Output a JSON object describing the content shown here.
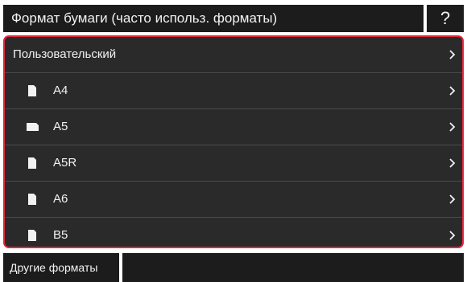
{
  "header": {
    "title": "Формат бумаги (часто использ. форматы)",
    "help_label": "?"
  },
  "list": {
    "items": [
      {
        "label": "Пользовательский",
        "icon": "none"
      },
      {
        "label": "A4",
        "icon": "portrait-paper-icon"
      },
      {
        "label": "A5",
        "icon": "landscape-paper-icon"
      },
      {
        "label": "A5R",
        "icon": "portrait-paper-icon"
      },
      {
        "label": "A6",
        "icon": "portrait-paper-icon"
      },
      {
        "label": "B5",
        "icon": "portrait-paper-icon"
      }
    ]
  },
  "footer": {
    "other_formats_label": "Другие форматы"
  },
  "colors": {
    "highlight_border": "#e0283c",
    "panel_background": "#2a2a2a",
    "bar_background": "#1c1c1c",
    "text": "#f2f2f2"
  }
}
